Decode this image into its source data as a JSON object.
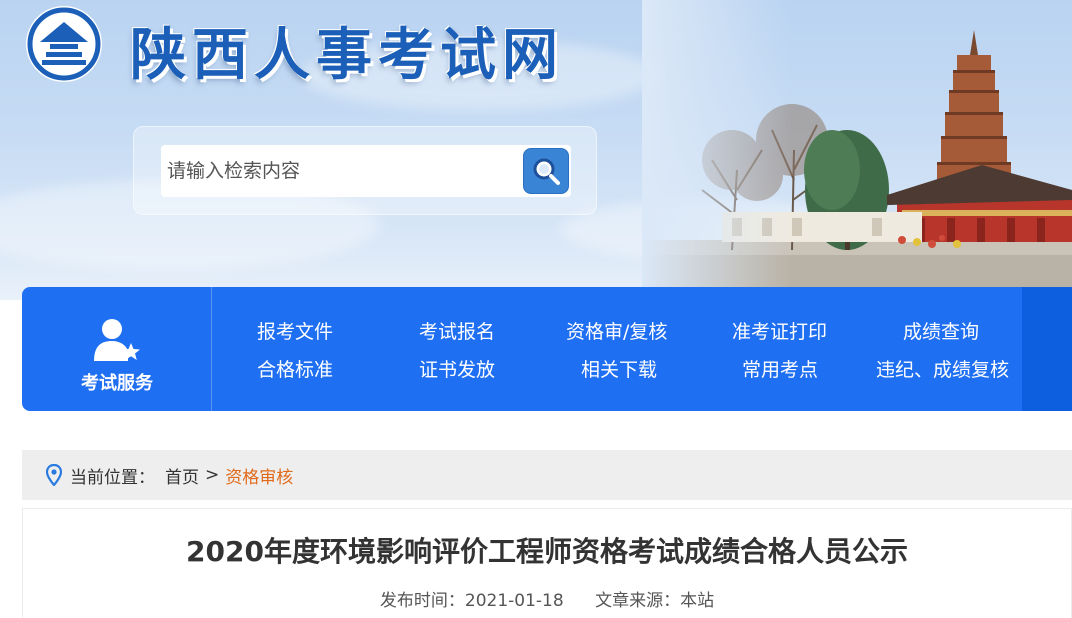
{
  "header": {
    "site_title": "陕西人事考试网",
    "logo_icon": "pagoda-emblem-icon",
    "brand_color": "#1b5fb8"
  },
  "search": {
    "placeholder": "请输入检索内容",
    "button_icon": "search-icon"
  },
  "nav": {
    "service_label": "考试服务",
    "service_icon": "user-star-icon",
    "background": "#1f6ff2",
    "links": [
      "报考文件",
      "考试报名",
      "资格审/复核",
      "准考证打印",
      "成绩查询",
      "合格标准",
      "证书发放",
      "相关下载",
      "常用考点",
      "违纪、成绩复核"
    ]
  },
  "breadcrumb": {
    "icon": "location-pin-icon",
    "prefix": "当前位置：",
    "home": "首页",
    "separator": ">",
    "current": "资格审核",
    "current_color": "#e06a1a"
  },
  "article": {
    "title": "2020年度环境影响评价工程师资格考试成绩合格人员公示",
    "publish_time": "发布时间：2021-01-18",
    "source": "文章来源：本站"
  }
}
